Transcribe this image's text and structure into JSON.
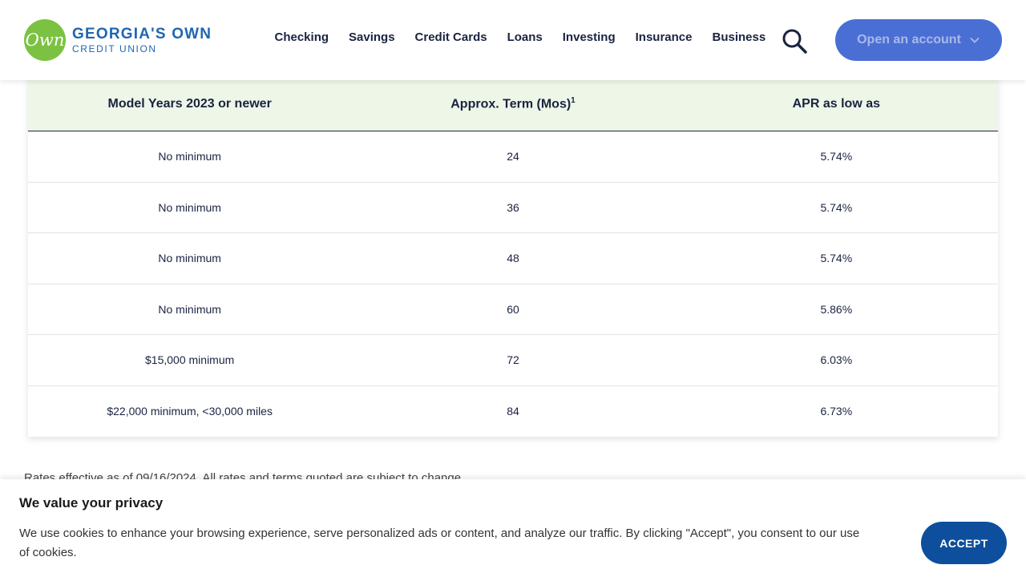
{
  "brand": {
    "logo_mark": "Own",
    "name_line1": "GEORGIA'S OWN",
    "name_line2": "CREDIT UNION",
    "colors": {
      "logo_green": "#7cc242",
      "brand_blue": "#1f66b0",
      "button_blue": "#4a6fd4",
      "accept_blue": "#0d4f9c",
      "header_row_bg": "#eef6e8"
    }
  },
  "nav": {
    "items": [
      "Checking",
      "Savings",
      "Credit Cards",
      "Loans",
      "Investing",
      "Insurance",
      "Business"
    ],
    "search_icon": "search-icon",
    "open_account_label": "Open an account",
    "open_account_icon": "chevron-down-icon"
  },
  "table": {
    "headers": [
      "Model Years 2023 or newer",
      "Approx. Term (Mos)",
      "APR as low as"
    ],
    "term_footnote_marker": "1",
    "rows": [
      [
        "No minimum",
        "24",
        "5.74%"
      ],
      [
        "No minimum",
        "36",
        "5.74%"
      ],
      [
        "No minimum",
        "48",
        "5.74%"
      ],
      [
        "No minimum",
        "60",
        "5.86%"
      ],
      [
        "$15,000 minimum",
        "72",
        "6.03%"
      ],
      [
        "$22,000 minimum, <30,000 miles",
        "84",
        "6.73%"
      ]
    ]
  },
  "footnote": "Rates effective as of 09/16/2024. All rates and terms quoted are subject to change.",
  "cookie": {
    "title": "We value your privacy",
    "text": "We use cookies to enhance your browsing experience, serve personalized ads or content, and analyze our traffic. By clicking \"Accept\", you consent to our use of cookies.",
    "accept_label": "ACCEPT"
  }
}
